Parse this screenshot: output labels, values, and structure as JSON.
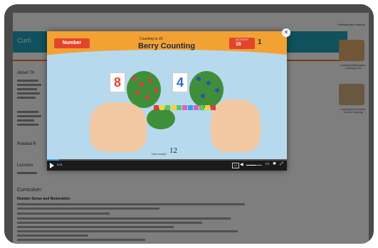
{
  "page": {
    "header_title": "Curri",
    "sidebar_about": "About Th",
    "sidebar_related": "Related R",
    "sidebar_lessons": "Lessons"
  },
  "curriculum": {
    "title": "Curriculum",
    "subtitle": "Number Sense and Numeration"
  },
  "right_panel": {
    "title": "Professional Learning",
    "items": [
      {
        "caption": "Learning Mathematics: Counting to 20"
      },
      {
        "caption": "Learning Environment: Outdoor Learning"
      }
    ]
  },
  "video": {
    "subject": "Number",
    "small_title": "Counting to 20",
    "title": "Berry Counting",
    "activity_label": "ACTIVITY",
    "activity_num": "16",
    "count": "1",
    "card_left": "8",
    "card_right": "4",
    "prompt": "How many?",
    "answer": "12",
    "time": "0:01",
    "progress": 0.05,
    "volume": 0.6,
    "colors": {
      "accent": "#3aa0e8",
      "header_orange": "#f2a233",
      "subject_red": "#e3452b"
    }
  },
  "icons": {
    "close": "close-icon",
    "play": "play-icon",
    "volume": "volume-icon",
    "settings": "gear-icon",
    "fullscreen": "fullscreen-icon"
  }
}
